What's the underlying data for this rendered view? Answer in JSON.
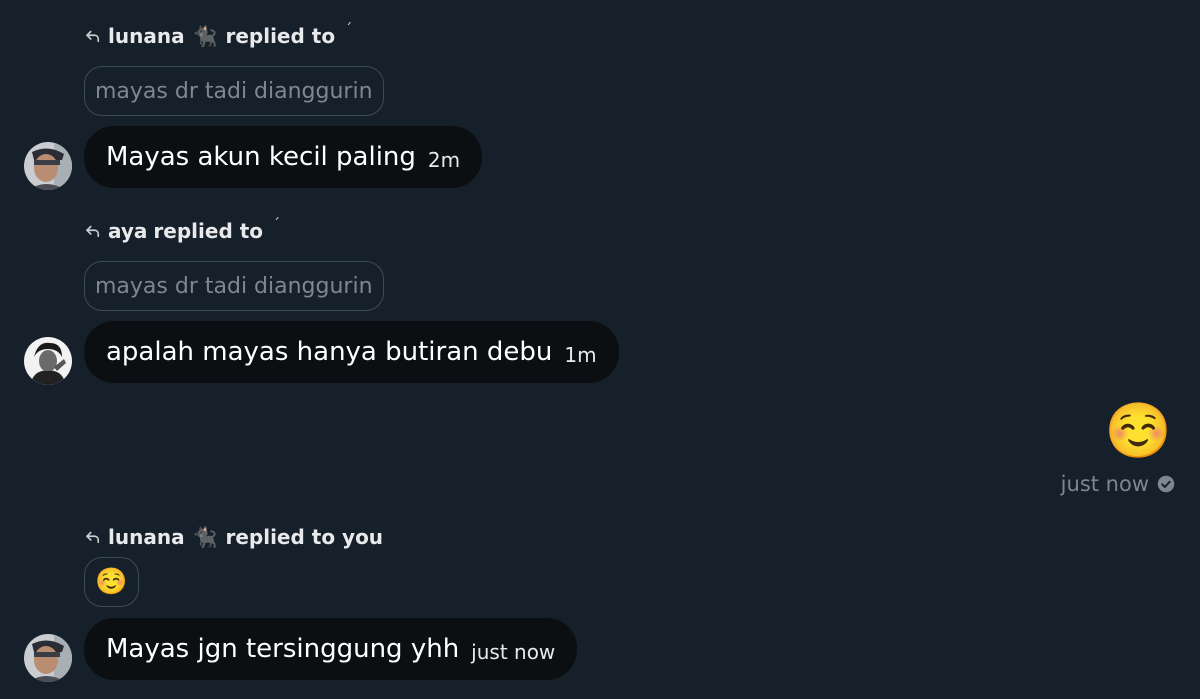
{
  "thread": [
    {
      "reply_header": {
        "name": "lunana",
        "name_glyph": "🐈‍⬛",
        "action": "replied to",
        "target_mark": "ˊ"
      },
      "quoted_text": "mayas dr tadi dianggurin",
      "message": {
        "text": "Mayas akun kecil paling",
        "time": "2m"
      }
    },
    {
      "reply_header": {
        "name": "aya",
        "action": "replied to",
        "target_mark": "ˊ"
      },
      "quoted_text": "mayas dr tadi dianggurin",
      "message": {
        "text": "apalah mayas hanya butiran debu",
        "time": "1m"
      }
    },
    {
      "reply_header": {
        "name": "lunana",
        "name_glyph": "🐈‍⬛",
        "action": "replied to you"
      },
      "quoted_emoji": "☺️",
      "message": {
        "text": "Mayas jgn tersinggung yhh",
        "time": "just now"
      }
    }
  ],
  "sent": {
    "emoji": "☺️",
    "status": "just now",
    "status_icon": "check-circle-icon"
  },
  "colors": {
    "background": "#16202a",
    "bubble": "#0c0f12",
    "muted_text": "#7c8791",
    "pill_border": "#3e4a55"
  }
}
